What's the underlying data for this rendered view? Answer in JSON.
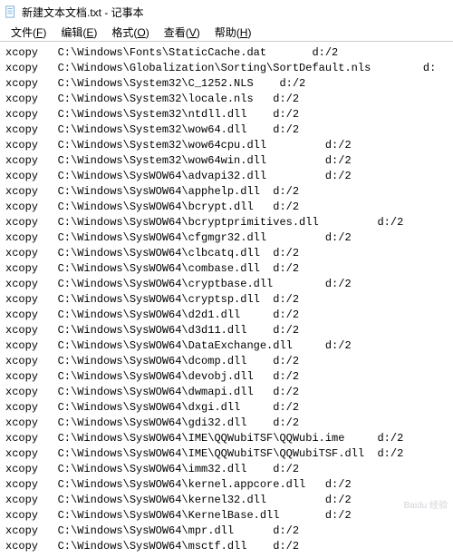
{
  "window": {
    "title": "新建文本文档.txt - 记事本"
  },
  "menu": {
    "file": {
      "label": "文件",
      "key": "F"
    },
    "edit": {
      "label": "编辑",
      "key": "E"
    },
    "format": {
      "label": "格式",
      "key": "O"
    },
    "view": {
      "label": "查看",
      "key": "V"
    },
    "help": {
      "label": "帮助",
      "key": "H"
    }
  },
  "lines": [
    "xcopy   C:\\Windows\\Fonts\\StaticCache.dat       d:/2",
    "xcopy   C:\\Windows\\Globalization\\Sorting\\SortDefault.nls        d:",
    "xcopy   C:\\Windows\\System32\\C_1252.NLS    d:/2",
    "xcopy   C:\\Windows\\System32\\locale.nls   d:/2",
    "xcopy   C:\\Windows\\System32\\ntdll.dll    d:/2",
    "xcopy   C:\\Windows\\System32\\wow64.dll    d:/2",
    "xcopy   C:\\Windows\\System32\\wow64cpu.dll         d:/2",
    "xcopy   C:\\Windows\\System32\\wow64win.dll         d:/2",
    "xcopy   C:\\Windows\\SysWOW64\\advapi32.dll         d:/2",
    "xcopy   C:\\Windows\\SysWOW64\\apphelp.dll  d:/2",
    "xcopy   C:\\Windows\\SysWOW64\\bcrypt.dll   d:/2",
    "xcopy   C:\\Windows\\SysWOW64\\bcryptprimitives.dll         d:/2",
    "xcopy   C:\\Windows\\SysWOW64\\cfgmgr32.dll         d:/2",
    "xcopy   C:\\Windows\\SysWOW64\\clbcatq.dll  d:/2",
    "xcopy   C:\\Windows\\SysWOW64\\combase.dll  d:/2",
    "xcopy   C:\\Windows\\SysWOW64\\cryptbase.dll        d:/2",
    "xcopy   C:\\Windows\\SysWOW64\\cryptsp.dll  d:/2",
    "xcopy   C:\\Windows\\SysWOW64\\d2d1.dll     d:/2",
    "xcopy   C:\\Windows\\SysWOW64\\d3d11.dll    d:/2",
    "xcopy   C:\\Windows\\SysWOW64\\DataExchange.dll     d:/2",
    "xcopy   C:\\Windows\\SysWOW64\\dcomp.dll    d:/2",
    "xcopy   C:\\Windows\\SysWOW64\\devobj.dll   d:/2",
    "xcopy   C:\\Windows\\SysWOW64\\dwmapi.dll   d:/2",
    "xcopy   C:\\Windows\\SysWOW64\\dxgi.dll     d:/2",
    "xcopy   C:\\Windows\\SysWOW64\\gdi32.dll    d:/2",
    "xcopy   C:\\Windows\\SysWOW64\\IME\\QQWubiTSF\\QQWubi.ime     d:/2",
    "xcopy   C:\\Windows\\SysWOW64\\IME\\QQWubiTSF\\QQWubiTSF.dll  d:/2",
    "xcopy   C:\\Windows\\SysWOW64\\imm32.dll    d:/2",
    "xcopy   C:\\Windows\\SysWOW64\\kernel.appcore.dll   d:/2",
    "xcopy   C:\\Windows\\SysWOW64\\kernel32.dll         d:/2",
    "xcopy   C:\\Windows\\SysWOW64\\KernelBase.dll       d:/2",
    "xcopy   C:\\Windows\\SysWOW64\\mpr.dll      d:/2",
    "xcopy   C:\\Windows\\SysWOW64\\msctf.dll    d:/2"
  ],
  "watermark": "Baidu 经验"
}
